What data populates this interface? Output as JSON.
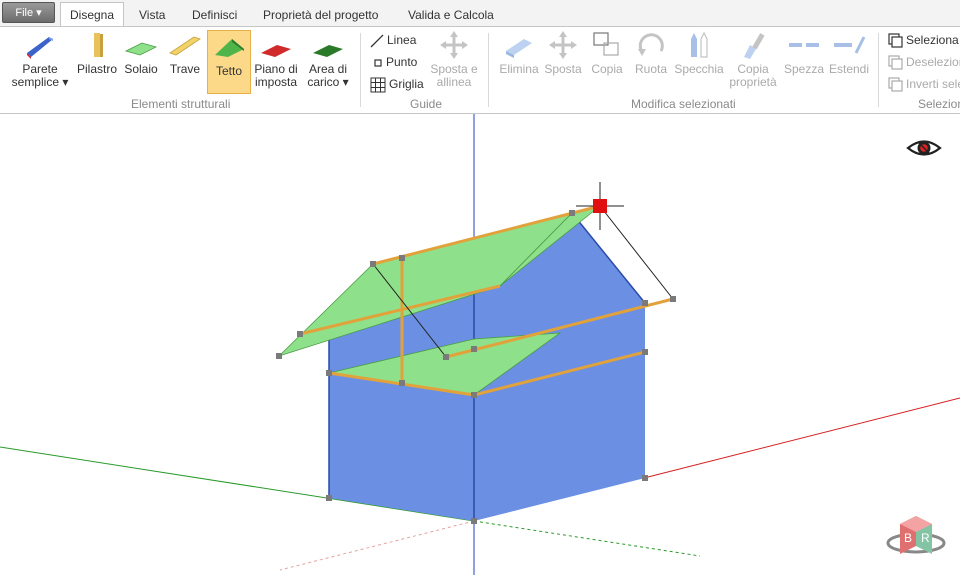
{
  "file_menu": {
    "label": "File ▾"
  },
  "tabs": [
    "Disegna",
    "Vista",
    "Definisci",
    "Proprietà del progetto",
    "Valida e Calcola"
  ],
  "ribbon": {
    "structural": {
      "group_label": "Elementi strutturali",
      "parete": "Parete",
      "parete2": "semplice ▾",
      "pilastro": "Pilastro",
      "solaio": "Solaio",
      "trave": "Trave",
      "tetto": "Tetto",
      "piano1": "Piano di",
      "piano2": "imposta",
      "area1": "Area di",
      "area2": "carico ▾"
    },
    "guides": {
      "group_label": "Guide",
      "linea": "Linea",
      "punto": "Punto",
      "griglia": "Griglia",
      "sposta1": "Sposta e",
      "sposta2": "allinea"
    },
    "modify": {
      "group_label": "Modifica selezionati",
      "elimina": "Elimina",
      "sposta": "Sposta",
      "copia": "Copia",
      "ruota": "Ruota",
      "specchia": "Specchia",
      "copia_prop1": "Copia",
      "copia_prop2": "proprietà",
      "spezza": "Spezza",
      "estendi": "Estendi"
    },
    "selection": {
      "group_label": "Selezione",
      "seleziona": "Seleziona",
      "deseleziona": "Deselezion",
      "inverti": "Inverti sele"
    }
  },
  "viewcube": {
    "left": "B",
    "right": "R"
  },
  "colors": {
    "wall": "#6b90e3",
    "roof": "#8fe08a",
    "beam": "#e2a23b",
    "axis_x": "#d62020",
    "axis_y": "#2a9a2a",
    "axis_z": "#2040c8",
    "selected_tab": "#fcd989"
  }
}
